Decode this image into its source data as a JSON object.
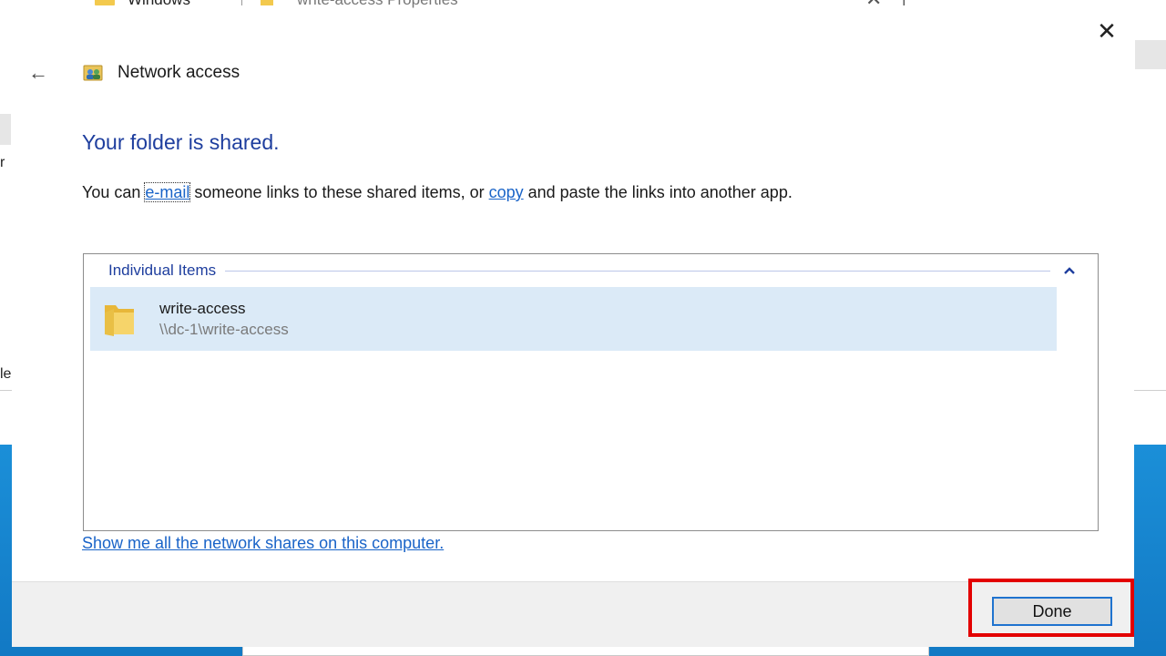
{
  "background": {
    "window_title_left": "Windows",
    "window_title_right": "write-access Properties",
    "edge_chars": [
      "r",
      "le"
    ]
  },
  "dialog": {
    "header_title": "Network access",
    "heading": "Your folder is shared.",
    "description": {
      "prefix": "You can ",
      "email_link": "e-mail",
      "middle": " someone links to these shared items, or ",
      "copy_link": "copy",
      "suffix": " and paste the links into another app."
    },
    "group": {
      "label": "Individual Items",
      "items": [
        {
          "name": "write-access",
          "path": "\\\\dc-1\\write-access"
        }
      ]
    },
    "shares_link": "Show me all the network shares on this computer.",
    "done_label": "Done"
  },
  "colors": {
    "heading": "#1e3e9e",
    "link": "#1a64c8",
    "selection": "#dbeaf7",
    "highlight": "#e30000",
    "desktop": "#1b8fd8"
  },
  "icons": {
    "close": "close-icon",
    "back": "back-arrow-icon",
    "network": "network-users-icon",
    "folder": "folder-icon",
    "collapse": "chevron-up-icon"
  }
}
